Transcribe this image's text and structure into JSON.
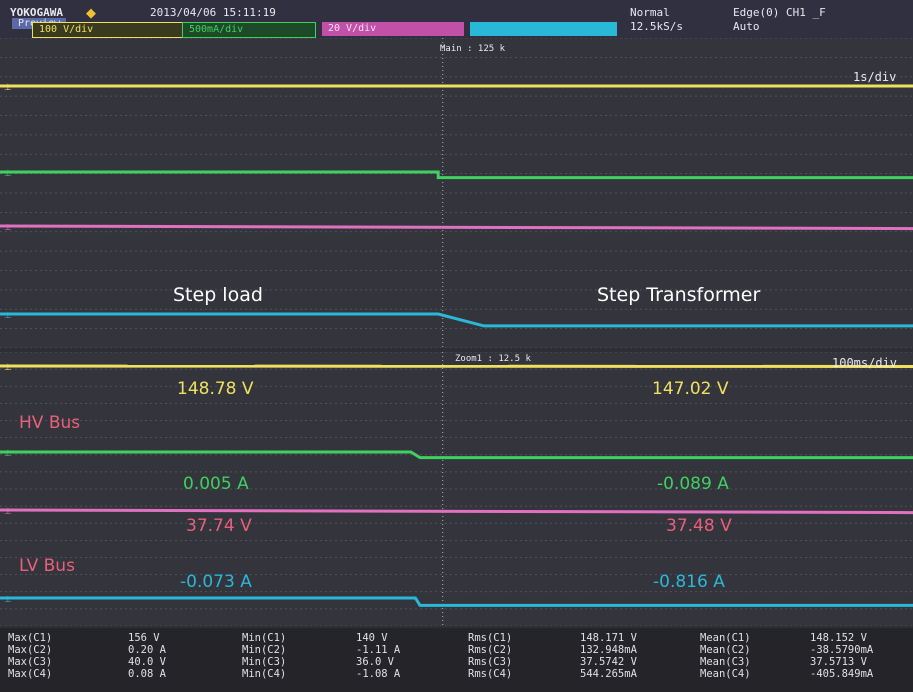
{
  "header": {
    "brand": "YOKOGAWA",
    "datetime": "2013/04/06 15:11:19",
    "mode": "Preview",
    "acq": "Normal",
    "sample_rate": "12.5kS/s",
    "trigger": "Edge(0) CH1 ̲F",
    "trigger_mode": "Auto"
  },
  "channels": [
    {
      "label": "100 V/div",
      "color": "#f0e060"
    },
    {
      "label": "500mA/div",
      "color": "#3fd060"
    },
    {
      "label": "20 V/div",
      "color": "#e070c0"
    },
    {
      "label": "",
      "color": "#2ab8d8"
    }
  ],
  "timebase": {
    "main_label": "Main : 125 k",
    "main_div": "1s/div",
    "zoom_label": "Zoom1 : 12.5 k",
    "zoom_div": "100ms/div"
  },
  "annotations": {
    "step_load": "Step load",
    "step_transformer": "Step Transformer"
  },
  "bus_labels": {
    "hv": "HV Bus",
    "lv": "LV Bus"
  },
  "measurements": {
    "left": {
      "c1": "148.78 V",
      "c2": "0.005 A",
      "c3": "37.74 V",
      "c4": "-0.073 A"
    },
    "right": {
      "c1": "147.02 V",
      "c2": "-0.089 A",
      "c3": "37.48 V",
      "c4": "-0.816 A"
    }
  },
  "stats": {
    "max_labels": "Max(C1)\nMax(C2)\nMax(C3)\nMax(C4)",
    "max_values": "156 V\n0.20 A\n40.0 V\n0.08 A",
    "min_labels": "Min(C1)\nMin(C2)\nMin(C3)\nMin(C4)",
    "min_values": "140 V\n-1.11 A\n36.0 V\n-1.08 A",
    "rms_labels": "Rms(C1)\nRms(C2)\nRms(C3)\nRms(C4)",
    "rms_values": "148.171 V\n132.948mA\n37.5742 V\n544.265mA",
    "mean_labels": "Mean(C1)\nMean(C2)\nMean(C3)\nMean(C4)",
    "mean_values": "148.152 V\n-38.5790mA\n37.5713 V\n-405.849mA"
  },
  "chart_data": {
    "type": "line",
    "title": "",
    "xlabel": "",
    "ylabel": "",
    "grid": true,
    "panels": [
      {
        "name": "main",
        "time_per_div": "1s/div",
        "x_divisions": 10,
        "series": [
          {
            "channel": "C1",
            "color": "#f0e060",
            "x": [
              0,
              10
            ],
            "y": [
              148.78,
              148.78
            ]
          },
          {
            "channel": "C2",
            "color": "#3fd060",
            "x": [
              0,
              4.8,
              4.8,
              10
            ],
            "y": [
              0.005,
              0.005,
              -0.089,
              -0.089
            ]
          },
          {
            "channel": "C3",
            "color": "#e070c0",
            "x": [
              0,
              10
            ],
            "y": [
              37.74,
              37.48
            ]
          },
          {
            "channel": "C4",
            "color": "#2ab8d8",
            "x": [
              0,
              4.8,
              5.3,
              10
            ],
            "y": [
              -0.073,
              -0.073,
              -0.816,
              -0.816
            ]
          }
        ]
      },
      {
        "name": "zoom1",
        "time_per_div": "100ms/div",
        "x_divisions": 10,
        "series": [
          {
            "channel": "C1",
            "color": "#f0e060",
            "x": [
              0,
              10
            ],
            "y": [
              148.78,
              147.02
            ]
          },
          {
            "channel": "C2",
            "color": "#3fd060",
            "x": [
              0,
              4.5,
              4.6,
              10
            ],
            "y": [
              0.005,
              0.005,
              -0.089,
              -0.089
            ]
          },
          {
            "channel": "C3",
            "color": "#e070c0",
            "x": [
              0,
              10
            ],
            "y": [
              37.74,
              37.48
            ]
          },
          {
            "channel": "C4",
            "color": "#2ab8d8",
            "x": [
              0,
              4.55,
              4.6,
              10
            ],
            "y": [
              -0.073,
              -0.073,
              -0.816,
              -0.816
            ]
          }
        ]
      }
    ]
  }
}
